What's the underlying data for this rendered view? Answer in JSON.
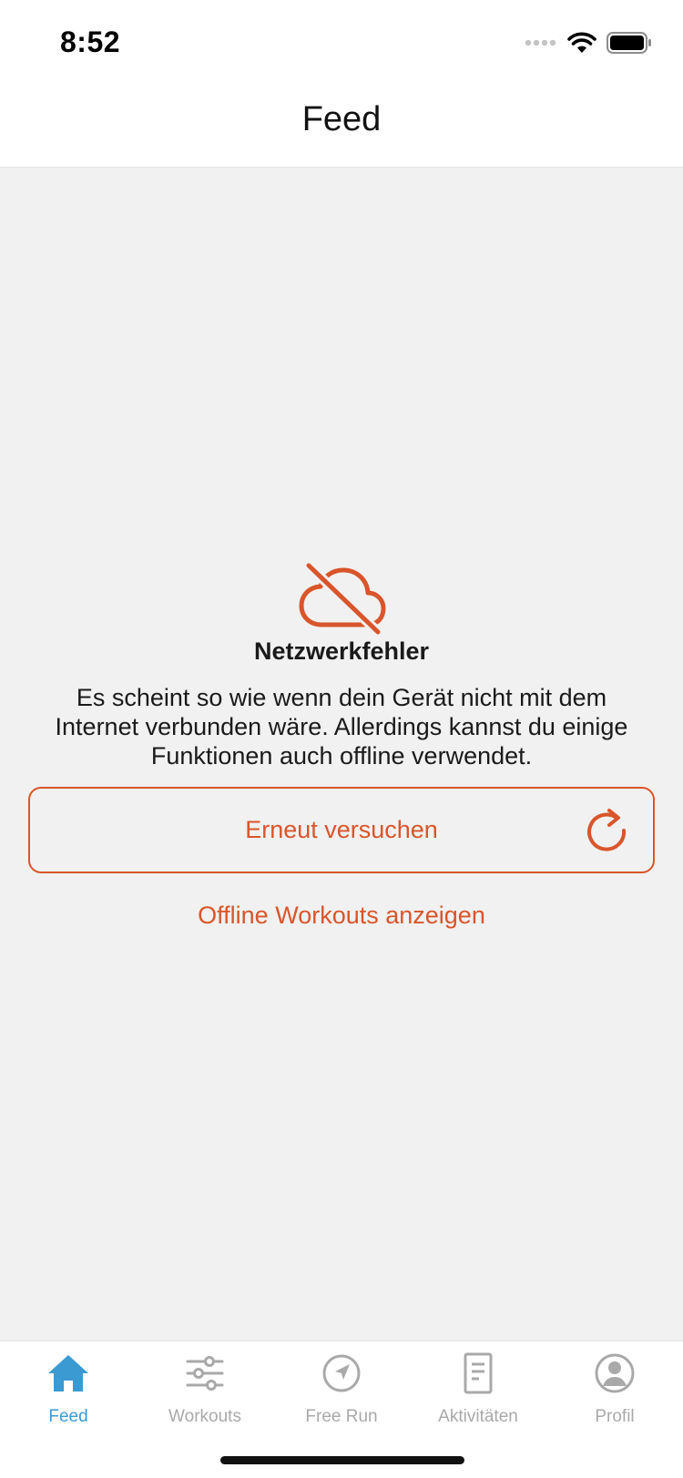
{
  "status_bar": {
    "time": "8:52",
    "icons": [
      "signal-dots-icon",
      "wifi-icon",
      "battery-icon"
    ]
  },
  "nav": {
    "title": "Feed"
  },
  "error": {
    "icon": "cloud-offline-icon",
    "title": "Netzwerkfehler",
    "message": "Es scheint so wie wenn dein Gerät nicht mit dem Internet verbunden wäre. Allerdings kannst du einige Funktionen auch offline verwendet."
  },
  "retry_button": {
    "label": "Erneut versuchen",
    "icon": "refresh-icon"
  },
  "offline_link": {
    "label": "Offline Workouts anzeigen"
  },
  "tab_bar": {
    "items": [
      {
        "label": "Feed",
        "icon": "home-icon",
        "active": true
      },
      {
        "label": "Workouts",
        "icon": "sliders-icon",
        "active": false
      },
      {
        "label": "Free Run",
        "icon": "navigation-icon",
        "active": false
      },
      {
        "label": "Aktivitäten",
        "icon": "document-icon",
        "active": false
      },
      {
        "label": "Profil",
        "icon": "user-icon",
        "active": false
      }
    ]
  },
  "colors": {
    "accent": "#d9552b",
    "tab_active": "#3a9ad1",
    "tab_inactive": "#a9a9a9",
    "background": "#f1f1f1"
  }
}
